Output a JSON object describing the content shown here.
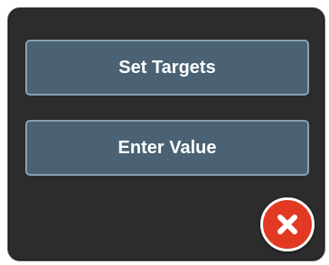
{
  "dialog": {
    "buttons": [
      {
        "label": "Set Targets"
      },
      {
        "label": "Enter Value"
      }
    ],
    "close_icon": "close-x-icon"
  },
  "colors": {
    "dialog_background": "#2c2c2c",
    "button_background": "#4a6274",
    "button_border": "#8aa0b0",
    "close_background": "#e23a22",
    "text": "#ffffff"
  }
}
